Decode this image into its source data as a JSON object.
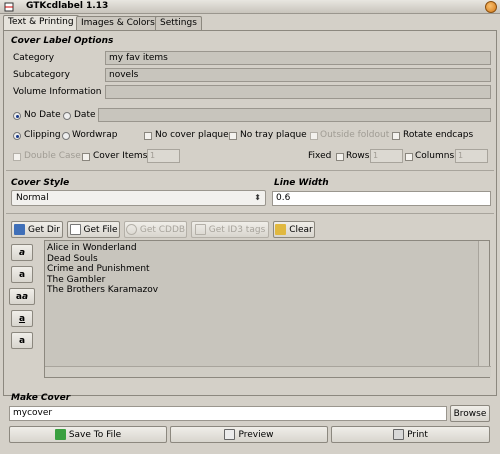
{
  "window": {
    "title": "GTKcdlabel 1.13"
  },
  "tabs": [
    {
      "label": "Text & Printing",
      "active": true
    },
    {
      "label": "Images & Colors",
      "active": false
    },
    {
      "label": "Settings",
      "active": false
    }
  ],
  "cover_label_options": {
    "title": "Cover Label Options",
    "category_label": "Category",
    "category_value": "my fav items",
    "subcategory_label": "Subcategory",
    "subcategory_value": "novels",
    "volume_label": "Volume Information",
    "volume_value": "",
    "no_date_label": "No Date",
    "date_label": "Date",
    "date_value": "",
    "clipping_label": "Clipping",
    "wordwrap_label": "Wordwrap",
    "no_cover_plaque_label": "No cover plaque",
    "no_tray_plaque_label": "No tray plaque",
    "outside_foldout_label": "Outside foldout",
    "rotate_endcaps_label": "Rotate endcaps",
    "double_case_label": "Double Case",
    "cover_items_label": "Cover Items",
    "cover_items_value": "1",
    "fixed_label": "Fixed",
    "rows_label": "Rows",
    "rows_value": "1",
    "columns_label": "Columns",
    "columns_value": "1"
  },
  "cover_style": {
    "title": "Cover Style",
    "value": "Normal"
  },
  "line_width": {
    "title": "Line Width",
    "value": "0.6"
  },
  "toolbar": {
    "get_dir": "Get Dir",
    "get_file": "Get File",
    "get_cddb": "Get CDDB",
    "get_id3": "Get ID3 tags",
    "clear": "Clear"
  },
  "items": [
    "Alice in Wonderland",
    "Dead Souls",
    "Crime and Punishment",
    "The Gambler",
    "The Brothers Karamazov"
  ],
  "make_cover": {
    "title": "Make Cover",
    "filename": "mycover",
    "browse": "Browse",
    "save_to_file": "Save To File",
    "preview": "Preview",
    "print": "Print"
  }
}
